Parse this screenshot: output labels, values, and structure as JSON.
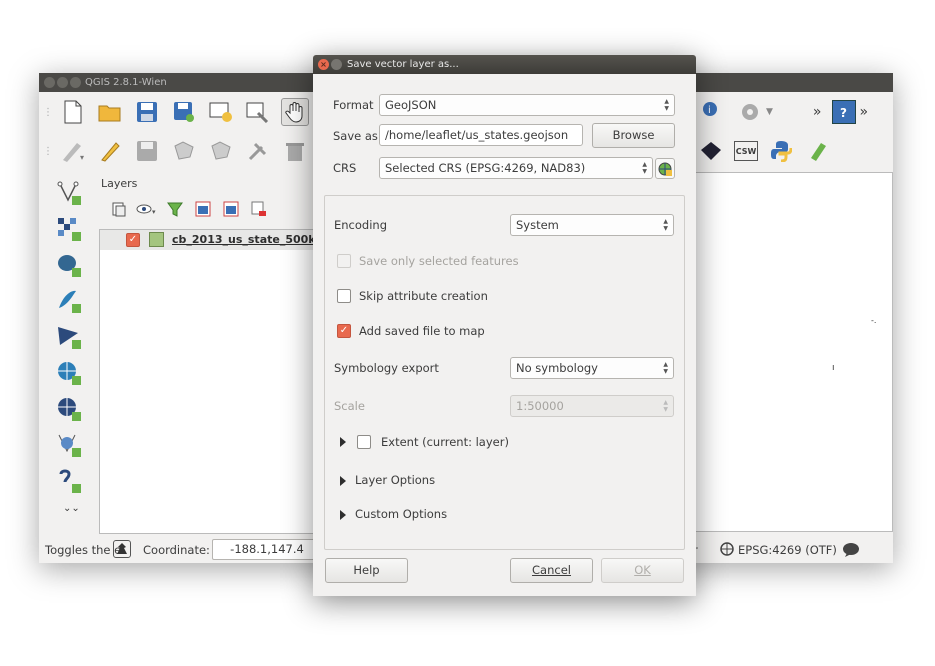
{
  "qgis": {
    "title": "QGIS 2.8.1-Wien",
    "layers_panel_title": "Layers",
    "layer_name": "cb_2013_us_state_500k",
    "status": {
      "toggles_text": "Toggles the e",
      "coordinate_label": "Coordinate:",
      "coordinate_value": "-188.1,147.4",
      "render_suffix": "r",
      "crs": "EPSG:4269 (OTF)"
    },
    "toolbar": {
      "overflow": "»",
      "csw": "CSW"
    }
  },
  "dialog": {
    "title": "Save vector layer as...",
    "format_label": "Format",
    "format_value": "GeoJSON",
    "save_as_label": "Save as",
    "save_as_value": "/home/leaflet/us_states.geojson",
    "browse_button": "Browse",
    "crs_label": "CRS",
    "crs_value": "Selected CRS (EPSG:4269, NAD83)",
    "encoding_label": "Encoding",
    "encoding_value": "System",
    "save_selected_label": "Save only selected features",
    "skip_attr_label": "Skip attribute creation",
    "add_to_map_label": "Add saved file to map",
    "symbology_label": "Symbology export",
    "symbology_value": "No symbology",
    "scale_label": "Scale",
    "scale_value": "1:50000",
    "extent_label": "Extent (current: layer)",
    "layer_options_label": "Layer Options",
    "custom_options_label": "Custom Options",
    "help_button": "Help",
    "cancel_button": "Cancel",
    "ok_button": "OK",
    "checkbox_states": {
      "save_selected": false,
      "skip_attr": false,
      "add_to_map": true,
      "extent": false
    }
  },
  "colors": {
    "accent": "#e8694e",
    "titlebar": "#3d3c38",
    "window_bg": "#f2f1f0"
  }
}
